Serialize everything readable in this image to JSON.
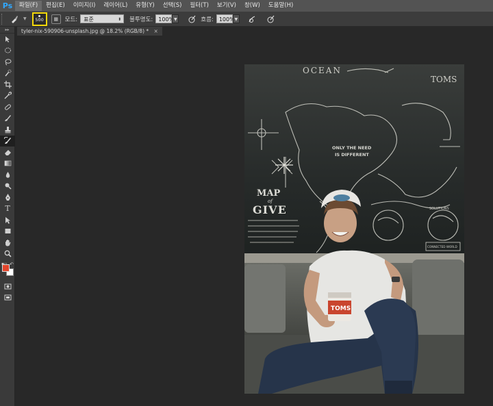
{
  "app": {
    "logo": "Ps"
  },
  "menubar": {
    "items": [
      "파일(F)",
      "편집(E)",
      "이미지(I)",
      "레이어(L)",
      "유형(Y)",
      "선택(S)",
      "필터(T)",
      "보기(V)",
      "창(W)",
      "도움말(H)"
    ]
  },
  "options": {
    "brush_size": "500",
    "mode_label": "모드:",
    "mode_value": "표준",
    "opacity_label": "불투명도:",
    "opacity_value": "100%",
    "flow_label": "흐름:",
    "flow_value": "100%"
  },
  "document": {
    "tab_title": "tyler-nix-590906-unsplash.jpg @ 18.2% (RGB/8) *",
    "close_glyph": "×"
  },
  "colors": {
    "foreground": "#e2452c",
    "background": "#ffffff",
    "highlight": "#f5d90a"
  },
  "photo_text": {
    "map_line1": "MAP",
    "map_line2": "of",
    "map_line3": "GIVE",
    "cup_brand": "TOMS",
    "toms_top": "TOMS",
    "ocean": "OCEAN",
    "only_need": "ONLY THE NEED",
    "is_different": "IS DIFFERENT",
    "connected": "CONNECTED WORLD",
    "solutions": "SOLUTIONS"
  },
  "tools": [
    "move-tool-icon",
    "marquee-tool-icon",
    "lasso-tool-icon",
    "quick-select-icon",
    "crop-tool-icon",
    "eyedropper-icon",
    "healing-brush-icon",
    "brush-tool-icon",
    "clone-stamp-icon",
    "history-brush-icon",
    "eraser-icon",
    "gradient-icon",
    "blur-icon",
    "dodge-icon",
    "pen-tool-icon",
    "type-tool-icon",
    "path-select-icon",
    "rectangle-tool-icon",
    "hand-tool-icon",
    "zoom-tool-icon"
  ]
}
